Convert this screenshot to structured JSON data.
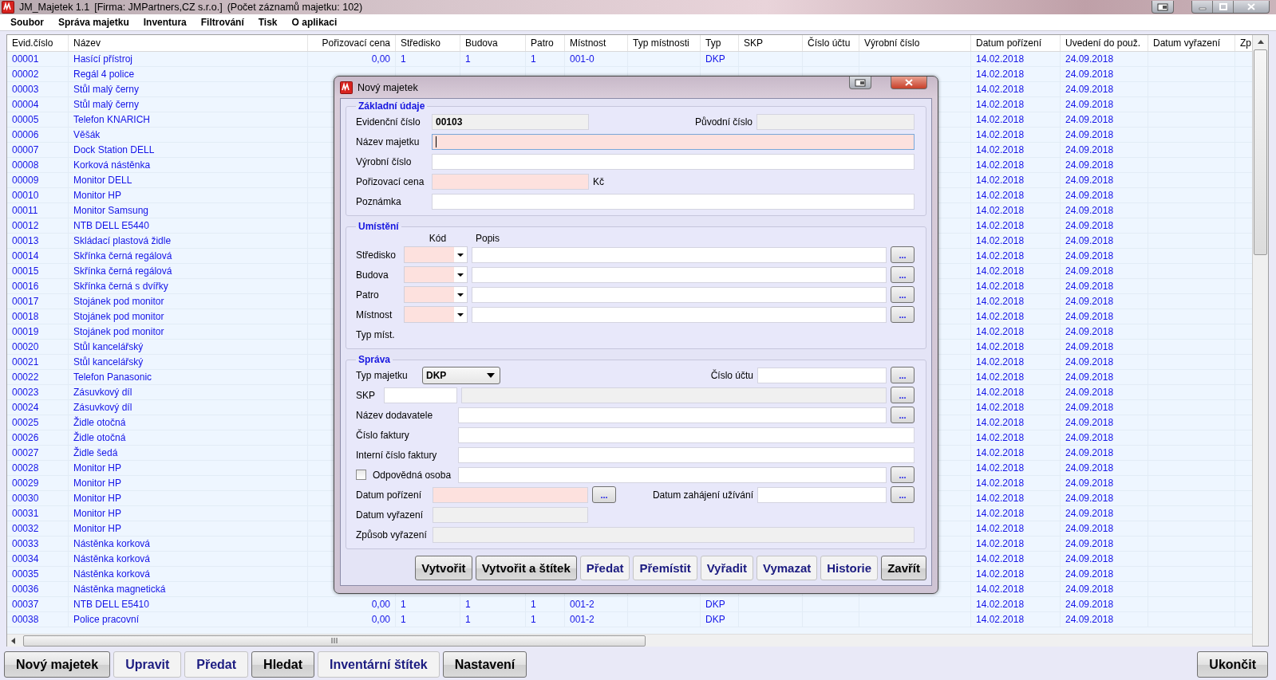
{
  "window": {
    "title": "JM_Majetek 1.1",
    "company": "[Firma: JMPartners,CZ s.r.o.]",
    "count": "(Počet záznamů majetku: 102)"
  },
  "menu": [
    "Soubor",
    "Správa majetku",
    "Inventura",
    "Filtrování",
    "Tisk",
    "O aplikaci"
  ],
  "table": {
    "columns": [
      "Evid.číslo",
      "Název",
      "Pořizovací cena",
      "Středisko",
      "Budova",
      "Patro",
      "Místnost",
      "Typ místnosti",
      "Typ",
      "SKP",
      "Číslo účtu",
      "Výrobní číslo",
      "Datum pořízení",
      "Uvedení do použ.",
      "Datum vyřazení",
      "Zp"
    ],
    "rows": [
      {
        "evid": "00001",
        "name": "Hasící přístroj",
        "price": "0,00",
        "center": "1",
        "building": "1",
        "floor": "1",
        "room": "001-0",
        "type": "DKP",
        "acquired": "14.02.2018",
        "in_use": "24.09.2018"
      },
      {
        "evid": "00002",
        "name": "Regál 4 police",
        "acquired": "14.02.2018",
        "in_use": "24.09.2018"
      },
      {
        "evid": "00003",
        "name": "Stůl malý černy",
        "acquired": "14.02.2018",
        "in_use": "24.09.2018"
      },
      {
        "evid": "00004",
        "name": "Stůl malý černy",
        "acquired": "14.02.2018",
        "in_use": "24.09.2018"
      },
      {
        "evid": "00005",
        "name": "Telefon KNARICH",
        "acquired": "14.02.2018",
        "in_use": "24.09.2018"
      },
      {
        "evid": "00006",
        "name": "Věšák",
        "acquired": "14.02.2018",
        "in_use": "24.09.2018"
      },
      {
        "evid": "00007",
        "name": "Dock Station DELL",
        "acquired": "14.02.2018",
        "in_use": "24.09.2018"
      },
      {
        "evid": "00008",
        "name": "Korková nástěnka",
        "acquired": "14.02.2018",
        "in_use": "24.09.2018"
      },
      {
        "evid": "00009",
        "name": "Monitor DELL",
        "acquired": "14.02.2018",
        "in_use": "24.09.2018"
      },
      {
        "evid": "00010",
        "name": "Monitor HP",
        "acquired": "14.02.2018",
        "in_use": "24.09.2018"
      },
      {
        "evid": "00011",
        "name": "Monitor Samsung",
        "acquired": "14.02.2018",
        "in_use": "24.09.2018"
      },
      {
        "evid": "00012",
        "name": "NTB DELL E5440",
        "acquired": "14.02.2018",
        "in_use": "24.09.2018"
      },
      {
        "evid": "00013",
        "name": "Skládací plastová židle",
        "acquired": "14.02.2018",
        "in_use": "24.09.2018"
      },
      {
        "evid": "00014",
        "name": "Skřínka černá regálová",
        "acquired": "14.02.2018",
        "in_use": "24.09.2018"
      },
      {
        "evid": "00015",
        "name": "Skřínka černá regálová",
        "acquired": "14.02.2018",
        "in_use": "24.09.2018"
      },
      {
        "evid": "00016",
        "name": "Skřínka černá s dvířky",
        "acquired": "14.02.2018",
        "in_use": "24.09.2018"
      },
      {
        "evid": "00017",
        "name": "Stojánek pod monitor",
        "acquired": "14.02.2018",
        "in_use": "24.09.2018"
      },
      {
        "evid": "00018",
        "name": "Stojánek pod monitor",
        "acquired": "14.02.2018",
        "in_use": "24.09.2018"
      },
      {
        "evid": "00019",
        "name": "Stojánek pod monitor",
        "acquired": "14.02.2018",
        "in_use": "24.09.2018"
      },
      {
        "evid": "00020",
        "name": "Stůl kancelářský",
        "acquired": "14.02.2018",
        "in_use": "24.09.2018"
      },
      {
        "evid": "00021",
        "name": "Stůl kancelářský",
        "acquired": "14.02.2018",
        "in_use": "24.09.2018"
      },
      {
        "evid": "00022",
        "name": "Telefon Panasonic",
        "acquired": "14.02.2018",
        "in_use": "24.09.2018"
      },
      {
        "evid": "00023",
        "name": "Zásuvkový díl",
        "acquired": "14.02.2018",
        "in_use": "24.09.2018"
      },
      {
        "evid": "00024",
        "name": "Zásuvkový díl",
        "acquired": "14.02.2018",
        "in_use": "24.09.2018"
      },
      {
        "evid": "00025",
        "name": "Židle otočná",
        "acquired": "14.02.2018",
        "in_use": "24.09.2018"
      },
      {
        "evid": "00026",
        "name": "Židle otočná",
        "acquired": "14.02.2018",
        "in_use": "24.09.2018"
      },
      {
        "evid": "00027",
        "name": "Židle šedá",
        "acquired": "14.02.2018",
        "in_use": "24.09.2018"
      },
      {
        "evid": "00028",
        "name": "Monitor HP",
        "acquired": "14.02.2018",
        "in_use": "24.09.2018"
      },
      {
        "evid": "00029",
        "name": "Monitor HP",
        "acquired": "14.02.2018",
        "in_use": "24.09.2018"
      },
      {
        "evid": "00030",
        "name": "Monitor HP",
        "acquired": "14.02.2018",
        "in_use": "24.09.2018"
      },
      {
        "evid": "00031",
        "name": "Monitor HP",
        "acquired": "14.02.2018",
        "in_use": "24.09.2018"
      },
      {
        "evid": "00032",
        "name": "Monitor HP",
        "acquired": "14.02.2018",
        "in_use": "24.09.2018"
      },
      {
        "evid": "00033",
        "name": "Nástěnka korková",
        "acquired": "14.02.2018",
        "in_use": "24.09.2018"
      },
      {
        "evid": "00034",
        "name": "Nástěnka korková",
        "acquired": "14.02.2018",
        "in_use": "24.09.2018"
      },
      {
        "evid": "00035",
        "name": "Nástěnka korková",
        "acquired": "14.02.2018",
        "in_use": "24.09.2018"
      },
      {
        "evid": "00036",
        "name": "Nástěnka magnetická",
        "acquired": "14.02.2018",
        "in_use": "24.09.2018"
      },
      {
        "evid": "00037",
        "name": "NTB DELL E5410",
        "price": "0,00",
        "center": "1",
        "building": "1",
        "floor": "1",
        "room": "001-2",
        "type": "DKP",
        "acquired": "14.02.2018",
        "in_use": "24.09.2018"
      },
      {
        "evid": "00038",
        "name": "Police pracovní",
        "price": "0,00",
        "center": "1",
        "building": "1",
        "floor": "1",
        "room": "001-2",
        "type": "DKP",
        "acquired": "14.02.2018",
        "in_use": "24.09.2018"
      }
    ]
  },
  "dialog": {
    "title": "Nový majetek",
    "basic": {
      "title": "Základní údaje",
      "evid": {
        "label": "Evidenční číslo",
        "value": "00103",
        "kind": "readonly",
        "focused": false
      },
      "original": {
        "label": "Původní číslo",
        "kind": "readonly",
        "focused": false
      },
      "name": {
        "label": "Název majetku",
        "kind": "required",
        "focused": true
      },
      "serial": {
        "label": "Výrobní číslo",
        "kind": "normal",
        "focused": false
      },
      "price": {
        "label": "Pořizovací cena",
        "kind": "required",
        "focused": false,
        "unit": "Kč"
      },
      "note": {
        "label": "Poznámka",
        "kind": "normal",
        "focused": false
      }
    },
    "location": {
      "title": "Umístění",
      "code_header": "Kód",
      "desc_header": "Popis",
      "rows": [
        {
          "label": "Středisko",
          "code": {
            "kind": "required"
          },
          "desc": {
            "kind": "normal"
          },
          "browse": "..."
        },
        {
          "label": "Budova",
          "code": {
            "kind": "required"
          },
          "desc": {
            "kind": "normal"
          },
          "browse": "..."
        },
        {
          "label": "Patro",
          "code": {
            "kind": "required"
          },
          "desc": {
            "kind": "normal"
          },
          "browse": "..."
        },
        {
          "label": "Místnost",
          "code": {
            "kind": "required"
          },
          "desc": {
            "kind": "normal"
          },
          "browse": "..."
        }
      ],
      "type_label": "Typ míst."
    },
    "admin": {
      "title": "Správa",
      "type": {
        "label": "Typ majetku",
        "value": "DKP"
      },
      "account": {
        "label": "Číslo účtu",
        "kind": "normal",
        "browse": "..."
      },
      "skp": {
        "label": "SKP",
        "code": {
          "kind": "normal"
        },
        "desc": {
          "kind": "readonly"
        },
        "browse": "..."
      },
      "supplier": {
        "label": "Název dodavatele",
        "kind": "normal",
        "browse": "..."
      },
      "invoice": {
        "label": "Číslo faktury",
        "kind": "normal"
      },
      "internal_invoice": {
        "label": "Interní číslo faktury",
        "kind": "normal"
      },
      "responsible": {
        "label": "Odpovědná osoba",
        "checked": false,
        "kind": "normal",
        "browse": "..."
      },
      "acquired": {
        "label": "Datum pořízení",
        "kind": "required",
        "browse": "..."
      },
      "start": {
        "label": "Datum zahájení užívání",
        "kind": "normal",
        "browse": "..."
      },
      "disposed": {
        "label": "Datum vyřazení",
        "kind": "readonly"
      },
      "method": {
        "label": "Způsob vyřazení",
        "kind": "readonly"
      }
    },
    "buttons": [
      {
        "label": "Vytvořit",
        "disabled": false
      },
      {
        "label": "Vytvořit a štítek",
        "disabled": false
      },
      {
        "label": "Předat",
        "disabled": true
      },
      {
        "label": "Přemístit",
        "disabled": true
      },
      {
        "label": "Vyřadit",
        "disabled": true
      },
      {
        "label": "Vymazat",
        "disabled": true
      },
      {
        "label": "Historie",
        "disabled": true
      },
      {
        "label": "Zavřít",
        "disabled": false
      }
    ]
  },
  "toolbar": {
    "buttons": [
      {
        "label": "Nový majetek",
        "disabled": false
      },
      {
        "label": "Upravit",
        "disabled": true
      },
      {
        "label": "Předat",
        "disabled": true
      },
      {
        "label": "Hledat",
        "disabled": false
      },
      {
        "label": "Inventární štítek",
        "disabled": true
      },
      {
        "label": "Nastavení",
        "disabled": false
      }
    ],
    "exit": {
      "label": "Ukončit",
      "disabled": false
    }
  }
}
